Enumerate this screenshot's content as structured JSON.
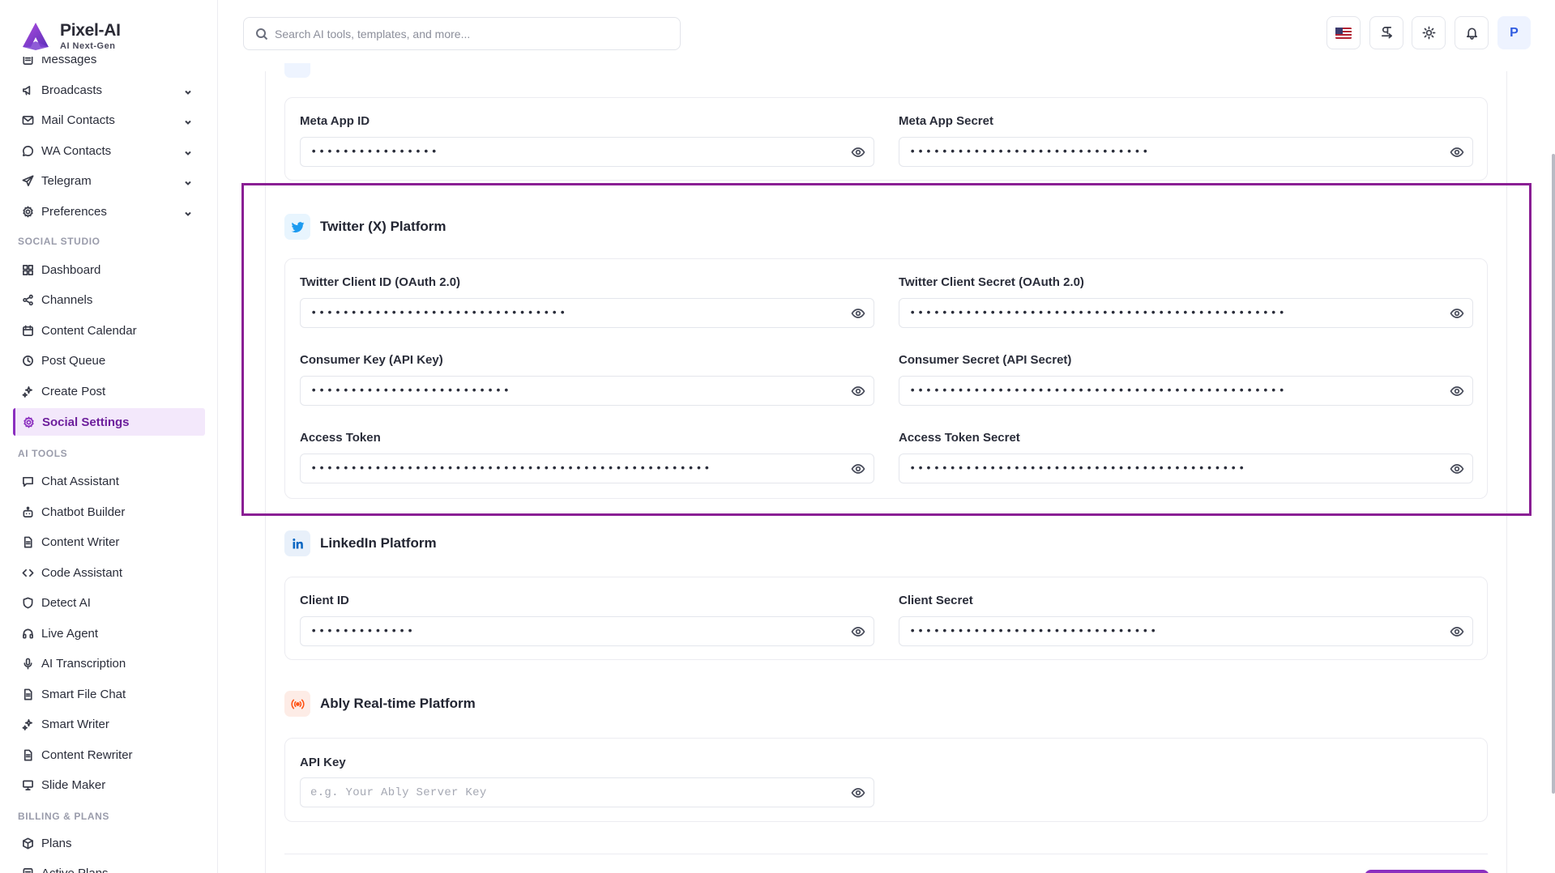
{
  "brand": {
    "name": "Pixel-AI",
    "tagline": "AI Next-Gen"
  },
  "search": {
    "placeholder": "Search AI tools, templates, and more..."
  },
  "user": {
    "initial": "P"
  },
  "sidebar": {
    "items": [
      {
        "label": "Messages",
        "icon": "list-icon",
        "chevron": false
      },
      {
        "label": "Broadcasts",
        "icon": "megaphone-icon",
        "chevron": true
      },
      {
        "label": "Mail Contacts",
        "icon": "mail-icon",
        "chevron": true
      },
      {
        "label": "WA Contacts",
        "icon": "chat-bubble-icon",
        "chevron": true
      },
      {
        "label": "Telegram",
        "icon": "send-icon",
        "chevron": true
      },
      {
        "label": "Preferences",
        "icon": "gear-icon",
        "chevron": true
      }
    ],
    "sections": [
      {
        "label": "SOCIAL STUDIO",
        "items": [
          {
            "label": "Dashboard",
            "icon": "grid-icon"
          },
          {
            "label": "Channels",
            "icon": "share-icon"
          },
          {
            "label": "Content Calendar",
            "icon": "calendar-icon"
          },
          {
            "label": "Post Queue",
            "icon": "clock-icon"
          },
          {
            "label": "Create Post",
            "icon": "sparkle-icon"
          },
          {
            "label": "Social Settings",
            "icon": "gear-icon",
            "active": true
          }
        ]
      },
      {
        "label": "AI TOOLS",
        "items": [
          {
            "label": "Chat Assistant",
            "icon": "chat-icon"
          },
          {
            "label": "Chatbot Builder",
            "icon": "bot-icon"
          },
          {
            "label": "Content Writer",
            "icon": "document-icon"
          },
          {
            "label": "Code Assistant",
            "icon": "code-icon"
          },
          {
            "label": "Detect AI",
            "icon": "shield-icon"
          },
          {
            "label": "Live Agent",
            "icon": "headset-icon"
          },
          {
            "label": "AI Transcription",
            "icon": "mic-icon"
          },
          {
            "label": "Smart File Chat",
            "icon": "document-icon"
          },
          {
            "label": "Smart Writer",
            "icon": "sparkle-icon"
          },
          {
            "label": "Content Rewriter",
            "icon": "document-icon"
          },
          {
            "label": "Slide Maker",
            "icon": "presentation-icon"
          }
        ]
      },
      {
        "label": "BILLING & PLANS",
        "items": [
          {
            "label": "Plans",
            "icon": "box-icon"
          },
          {
            "label": "Active Plans",
            "icon": "list-icon"
          }
        ]
      }
    ]
  },
  "platforms": {
    "meta": {
      "fields": [
        {
          "label": "Meta App ID",
          "value": "••••••••••••••••"
        },
        {
          "label": "Meta App Secret",
          "value": "••••••••••••••••••••••••••••••"
        }
      ]
    },
    "twitter": {
      "title": "Twitter (X) Platform",
      "fields": [
        {
          "label": "Twitter Client ID (OAuth 2.0)",
          "value": "••••••••••••••••••••••••••••••••"
        },
        {
          "label": "Twitter Client Secret (OAuth 2.0)",
          "value": "•••••••••••••••••••••••••••••••••••••••••••••••"
        },
        {
          "label": "Consumer Key (API Key)",
          "value": "•••••••••••••••••••••••••"
        },
        {
          "label": "Consumer Secret (API Secret)",
          "value": "•••••••••••••••••••••••••••••••••••••••••••••••"
        },
        {
          "label": "Access Token",
          "value": "••••••••••••••••••••••••••••••••••••••••••••••••••"
        },
        {
          "label": "Access Token Secret",
          "value": "••••••••••••••••••••••••••••••••••••••••••"
        }
      ]
    },
    "linkedin": {
      "title": "LinkedIn Platform",
      "fields": [
        {
          "label": "Client ID",
          "value": "•••••••••••••"
        },
        {
          "label": "Client Secret",
          "value": "•••••••••••••••••••••••••••••••"
        }
      ]
    },
    "ably": {
      "title": "Ably Real-time Platform",
      "fields": [
        {
          "label": "API Key",
          "value": "",
          "placeholder": "e.g. Your Ably Server Key"
        }
      ]
    }
  },
  "colors": {
    "accent": "#8b2fbf",
    "highlight_border": "#8a1f94",
    "twitter_blue": "#1d9bf0",
    "linkedin_blue": "#0a66c2",
    "ably_orange": "#ff5416"
  }
}
